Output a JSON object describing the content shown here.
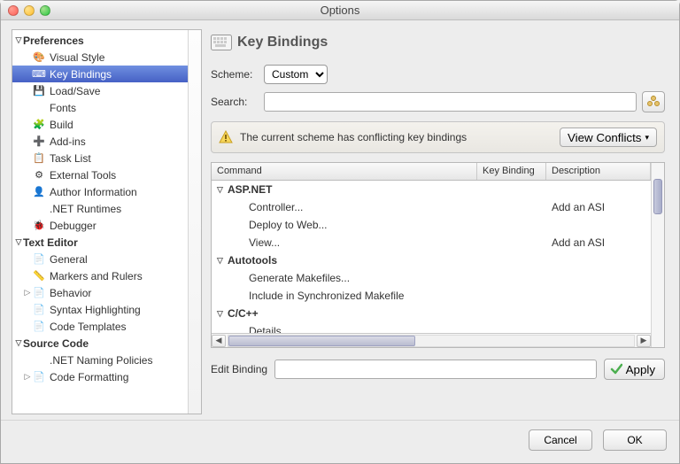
{
  "window": {
    "title": "Options"
  },
  "sidebar": {
    "groups": [
      {
        "label": "Preferences",
        "children": [
          {
            "label": "Visual Style",
            "icon": "palette"
          },
          {
            "label": "Key Bindings",
            "icon": "keyboard",
            "selected": true
          },
          {
            "label": "Load/Save",
            "icon": "floppy"
          },
          {
            "label": "Fonts",
            "icon": "blank"
          },
          {
            "label": "Build",
            "icon": "blocks"
          },
          {
            "label": "Add-ins",
            "icon": "plus-green"
          },
          {
            "label": "Task List",
            "icon": "checklist"
          },
          {
            "label": "External Tools",
            "icon": "gear"
          },
          {
            "label": "Author Information",
            "icon": "person"
          },
          {
            "label": ".NET Runtimes",
            "icon": "blank"
          },
          {
            "label": "Debugger",
            "icon": "bug"
          }
        ]
      },
      {
        "label": "Text Editor",
        "children": [
          {
            "label": "General",
            "icon": "doc"
          },
          {
            "label": "Markers and Rulers",
            "icon": "ruler"
          },
          {
            "label": "Behavior",
            "icon": "doc",
            "expandable": true
          },
          {
            "label": "Syntax Highlighting",
            "icon": "doc"
          },
          {
            "label": "Code Templates",
            "icon": "doc"
          }
        ]
      },
      {
        "label": "Source Code",
        "children": [
          {
            "label": ".NET Naming Policies",
            "icon": "blank"
          },
          {
            "label": "Code Formatting",
            "icon": "doc",
            "expandable": true
          }
        ]
      }
    ]
  },
  "main": {
    "title": "Key Bindings",
    "scheme_label": "Scheme:",
    "scheme_value": "Custom",
    "search_label": "Search:",
    "search_value": "",
    "notice_text": "The current scheme has conflicting key bindings",
    "view_conflicts": "View Conflicts",
    "columns": {
      "command": "Command",
      "keybinding": "Key Binding",
      "description": "Description"
    },
    "rows": [
      {
        "type": "group",
        "label": "ASP.NET"
      },
      {
        "type": "cmd",
        "label": "Controller...",
        "key": "",
        "desc": "Add an ASI"
      },
      {
        "type": "cmd",
        "label": "Deploy to Web...",
        "key": "",
        "desc": ""
      },
      {
        "type": "cmd",
        "label": "View...",
        "key": "",
        "desc": "Add an ASI"
      },
      {
        "type": "group",
        "label": "Autotools"
      },
      {
        "type": "cmd",
        "label": "Generate Makefiles...",
        "key": "",
        "desc": ""
      },
      {
        "type": "cmd",
        "label": "Include in Synchronized Makefile",
        "key": "",
        "desc": ""
      },
      {
        "type": "group",
        "label": "C/C++"
      },
      {
        "type": "cmd",
        "label": "Details...",
        "key": "",
        "desc": ""
      }
    ],
    "edit_binding_label": "Edit Binding",
    "edit_binding_value": "",
    "apply": "Apply"
  },
  "footer": {
    "cancel": "Cancel",
    "ok": "OK"
  },
  "icons": {
    "palette": "🎨",
    "keyboard": "⌨",
    "floppy": "💾",
    "blank": "",
    "blocks": "🧩",
    "plus-green": "➕",
    "checklist": "📋",
    "gear": "⚙",
    "person": "👤",
    "bug": "🐞",
    "doc": "📄",
    "ruler": "📏"
  }
}
